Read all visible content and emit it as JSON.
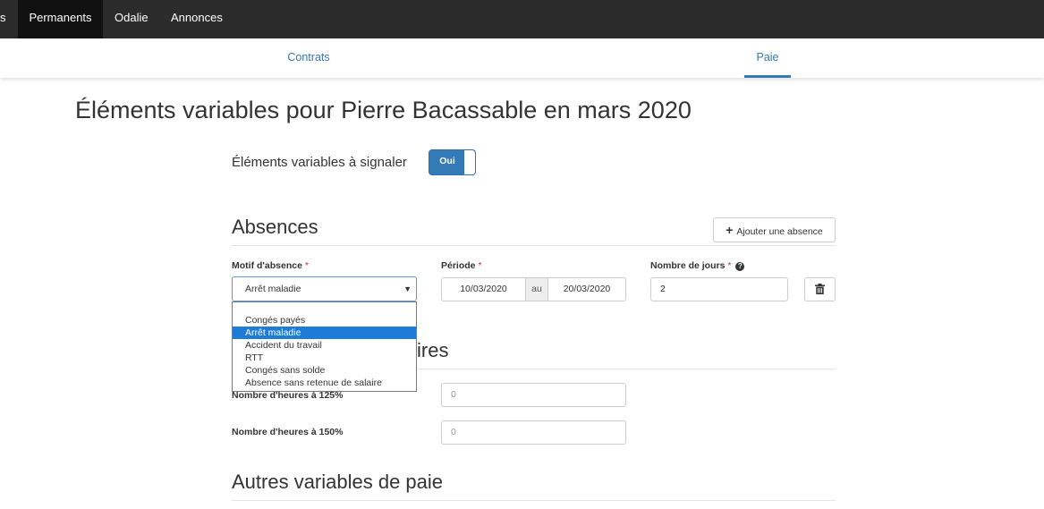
{
  "topnav": {
    "items": [
      {
        "label": "s"
      },
      {
        "label": "Permanents"
      },
      {
        "label": "Odalie"
      },
      {
        "label": "Annonces"
      }
    ]
  },
  "tabs": [
    {
      "label": "Contrats"
    },
    {
      "label": "Paie"
    }
  ],
  "page_title": "Éléments variables pour Pierre Bacassable en mars 2020",
  "signal": {
    "label": "Éléments variables à signaler",
    "toggle_label": "Oui"
  },
  "absences": {
    "title": "Absences",
    "add_button_label": "Ajouter une absence",
    "motif_label": "Motif d'absence",
    "periode_label": "Période",
    "jours_label": "Nombre de jours",
    "required_mark": "*",
    "motif_value": "Arrêt maladie",
    "date_from": "10/03/2020",
    "date_sep": "au",
    "date_to": "20/03/2020",
    "jours_value": "2",
    "options": [
      "Congés payés",
      "Arrêt maladie",
      "Accident du travail",
      "RTT",
      "Congés sans solde",
      "Absence sans retenue de salaire"
    ]
  },
  "hours": {
    "title_visible": "ires",
    "rows": [
      {
        "label": "Nombre d'heures à 125%",
        "value": "0"
      },
      {
        "label": "Nombre d'heures à 150%",
        "value": "0"
      }
    ]
  },
  "autres": {
    "title": "Autres variables de paie"
  }
}
